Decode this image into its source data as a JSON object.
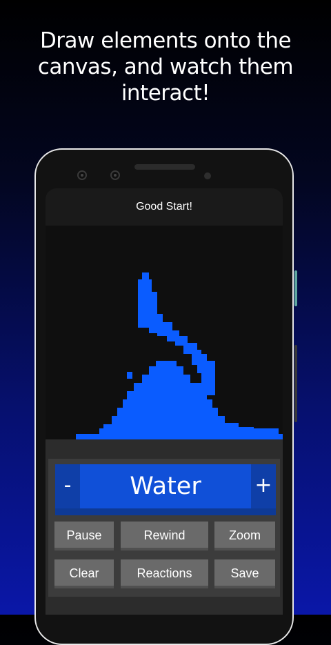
{
  "promo": {
    "headline_line1": "Draw elements onto the",
    "headline_line2": "canvas, and watch them",
    "headline_line3": "interact!"
  },
  "app": {
    "status": "Good Start!",
    "element_selector": {
      "prev_label": "-",
      "current": "Water",
      "next_label": "+"
    },
    "buttons": {
      "pause": "Pause",
      "rewind": "Rewind",
      "zoom": "Zoom",
      "clear": "Clear",
      "reactions": "Reactions",
      "save": "Save"
    }
  },
  "colors": {
    "water": "#0a5cff",
    "accent": "#1050d8",
    "canvas_bg": "#0f0f0f"
  }
}
